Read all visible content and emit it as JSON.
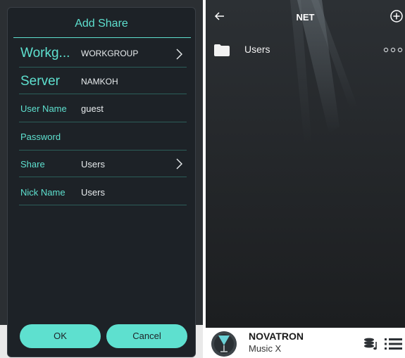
{
  "add_share_dialog": {
    "title": "Add Share",
    "rows": [
      {
        "label": "Workg...",
        "value": "WORKGROUP",
        "has_chevron": true
      },
      {
        "label": "Server",
        "value": "NAMKOH",
        "has_chevron": false
      },
      {
        "label": "User Name",
        "value": "guest",
        "has_chevron": false
      },
      {
        "label": "Password",
        "value": "",
        "has_chevron": false
      },
      {
        "label": "Share",
        "value": "Users",
        "has_chevron": true
      },
      {
        "label": "Nick Name",
        "value": "Users",
        "has_chevron": false
      }
    ],
    "ok_label": "OK",
    "cancel_label": "Cancel"
  },
  "browser": {
    "title": "NET",
    "back_icon": "back-arrow-icon",
    "add_icon": "add-circle-icon",
    "items": [
      {
        "label": "Users",
        "icon": "folder-icon",
        "more_icon": "more-options-icon"
      }
    ]
  },
  "player": {
    "title": "NOVATRON",
    "subtitle": "Music X",
    "queue_icon": "queue-music-icon",
    "menu_icon": "menu-icon"
  },
  "colors": {
    "accent": "#5ee0cf",
    "dialog_bg": "#1d2227",
    "browser_bg": "#202326"
  }
}
